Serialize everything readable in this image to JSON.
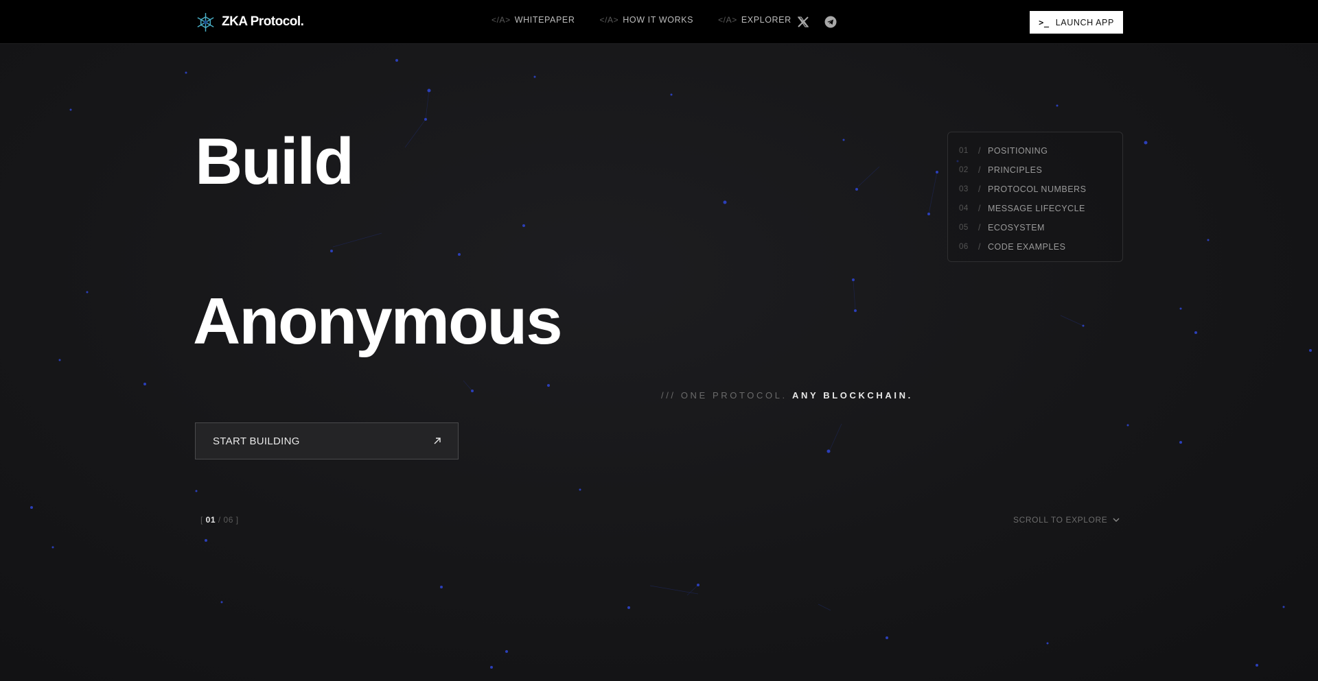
{
  "header": {
    "logo_text": "ZKA Protocol.",
    "nav": [
      {
        "tag": "</A>",
        "label": "WHITEPAPER"
      },
      {
        "tag": "</A>",
        "label": "HOW IT WORKS"
      },
      {
        "tag": "</A>",
        "label": "EXPLORER"
      }
    ],
    "social": [
      "x-icon",
      "telegram-icon"
    ],
    "launch_prompt": ">_",
    "launch_label": "LAUNCH APP"
  },
  "hero": {
    "line1": "Build",
    "line2": "Anonymous",
    "tagline_dim": "/// ONE PROTOCOL.",
    "tagline_bright": "ANY BLOCKCHAIN.",
    "cta_label": "START BUILDING"
  },
  "toc": [
    {
      "num": "01",
      "label": "POSITIONING"
    },
    {
      "num": "02",
      "label": "PRINCIPLES"
    },
    {
      "num": "03",
      "label": "PROTOCOL NUMBERS"
    },
    {
      "num": "04",
      "label": "MESSAGE LIFECYCLE"
    },
    {
      "num": "05",
      "label": "ECOSYSTEM"
    },
    {
      "num": "06",
      "label": "CODE EXAMPLES"
    }
  ],
  "pager": {
    "current": "01",
    "total": "06"
  },
  "scroll_label": "SCROLL TO EXPLORE",
  "colors": {
    "background": "#151517",
    "accent_dots": "#2a3fb0",
    "cta_bg": "#242426"
  }
}
